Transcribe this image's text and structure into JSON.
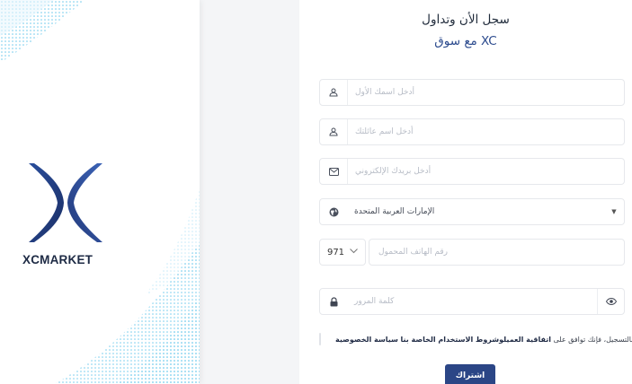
{
  "brand": {
    "name": "XCMARKET",
    "colors": {
      "primary": "#2b4686",
      "logo_dark": "#1f3a78",
      "logo_light": "#3b62b5",
      "pattern": "#5ec3ea"
    }
  },
  "form": {
    "heading_line1": "سجل الأن وتداول",
    "heading_line2": "مع سوق XC",
    "first_name": {
      "placeholder": "أدخل اسمك الأول",
      "icon": "user-icon"
    },
    "last_name": {
      "placeholder": "أدخل اسم عائلتك",
      "icon": "user-icon"
    },
    "email": {
      "placeholder": "أدخل بريدك الإلكتروني",
      "icon": "mail-icon"
    },
    "country": {
      "value": "الإمارات العربية المتحدة",
      "icon": "globe-icon"
    },
    "phone": {
      "code": "971",
      "placeholder": "رقم الهاتف المحمول"
    },
    "password": {
      "placeholder": "كلمة المرور",
      "icon": "lock-icon",
      "toggle_icon": "eye-icon"
    },
    "agreement": {
      "prefix": "بالتسجيل، فإنك توافق على",
      "link1": "اتفاقية العميل",
      "link2": "وشروط الاستخدام الخاصة بنا",
      "link3": "سياسة الخصوصية",
      "checked": false
    },
    "submit_label": "اشتراك"
  }
}
